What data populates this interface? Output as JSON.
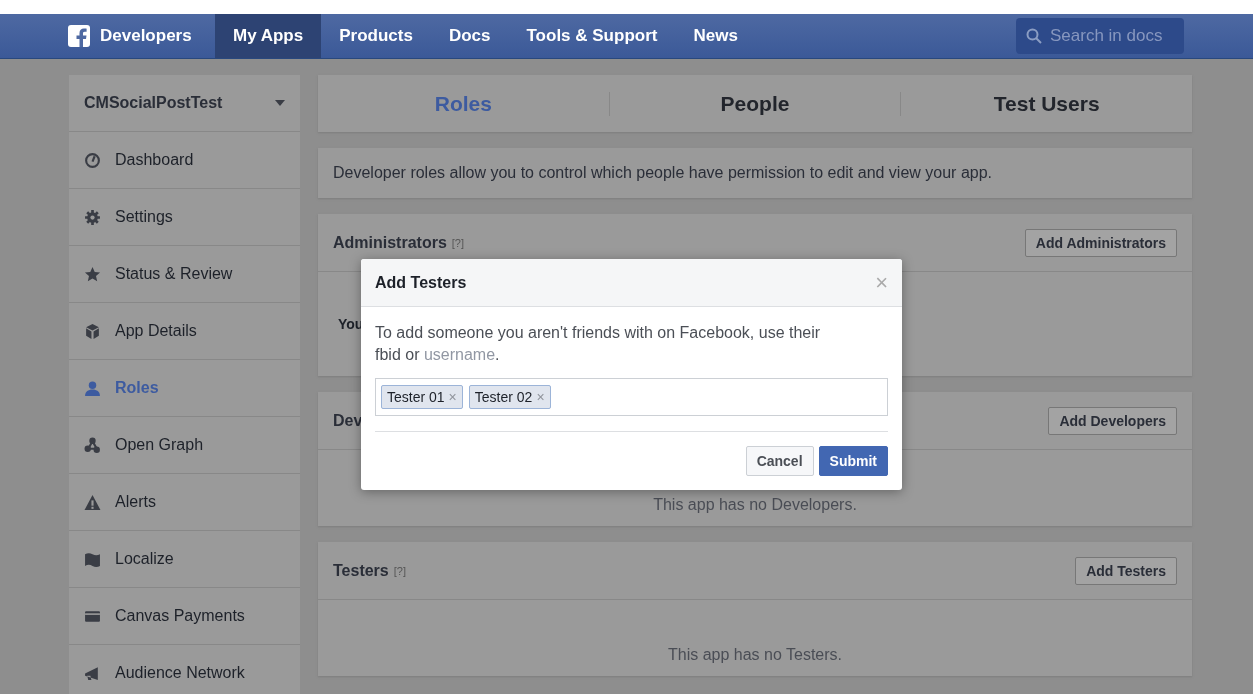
{
  "navbar": {
    "brand": "Developers",
    "items": [
      {
        "label": "My Apps",
        "selected": true
      },
      {
        "label": "Products",
        "selected": false
      },
      {
        "label": "Docs",
        "selected": false
      },
      {
        "label": "Tools & Support",
        "selected": false
      },
      {
        "label": "News",
        "selected": false
      }
    ],
    "search": {
      "placeholder": "Search in docs"
    }
  },
  "sidebar": {
    "app_name": "CMSocialPostTest",
    "items": [
      {
        "label": "Dashboard",
        "selected": false
      },
      {
        "label": "Settings",
        "selected": false
      },
      {
        "label": "Status & Review",
        "selected": false
      },
      {
        "label": "App Details",
        "selected": false
      },
      {
        "label": "Roles",
        "selected": true
      },
      {
        "label": "Open Graph",
        "selected": false
      },
      {
        "label": "Alerts",
        "selected": false
      },
      {
        "label": "Localize",
        "selected": false
      },
      {
        "label": "Canvas Payments",
        "selected": false
      },
      {
        "label": "Audience Network",
        "selected": false
      }
    ]
  },
  "tabs": [
    {
      "label": "Roles",
      "selected": true
    },
    {
      "label": "People",
      "selected": false
    },
    {
      "label": "Test Users",
      "selected": false
    }
  ],
  "description": "Developer roles allow you to control which people have permission to edit and view your app.",
  "sections": [
    {
      "title": "Administrators",
      "help": "[?]",
      "button": "Add Administrators",
      "body": "You",
      "kind": "member"
    },
    {
      "title": "Dev",
      "button": "Add Developers",
      "body": "This app has no Developers.",
      "kind": "empty"
    },
    {
      "title": "Testers",
      "help": "[?]",
      "button": "Add Testers",
      "body": "This app has no Testers.",
      "kind": "empty"
    }
  ],
  "dialog": {
    "title": "Add Testers",
    "close": "×",
    "text": "To add someone you aren't friends with on Facebook, use their fbid or ",
    "link": "username",
    "text_end": ".",
    "tokens": [
      {
        "label": "Tester 01",
        "remove": "×"
      },
      {
        "label": "Tester 02",
        "remove": "×"
      }
    ],
    "buttons": [
      {
        "label": "Cancel",
        "kind": "secondary"
      },
      {
        "label": "Submit",
        "kind": "primary"
      }
    ]
  }
}
